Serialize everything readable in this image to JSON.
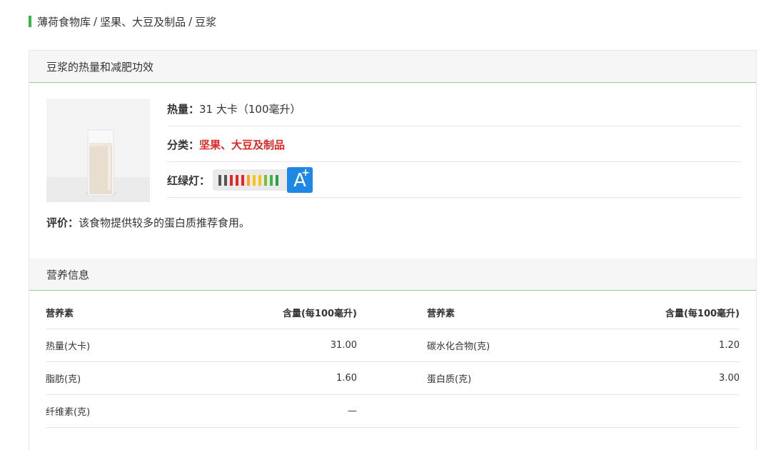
{
  "breadcrumb": {
    "home": "薄荷食物库",
    "sep1": "/",
    "category": "坚果、大豆及制品",
    "sep2": "/",
    "current": "豆浆"
  },
  "overview": {
    "title": "豆浆的热量和减肥功效",
    "calories_label": "热量：",
    "calories_value": "31 大卡（100毫升）",
    "category_label": "分类：",
    "category_value": "坚果、大豆及制品",
    "traffic_label": "红绿灯：",
    "grade": "A",
    "grade_plus": "+",
    "traffic_colors": [
      "#555555",
      "#555555",
      "#e22727",
      "#e22727",
      "#e22727",
      "#f5a623",
      "#f5c518",
      "#f5c518",
      "#7cbd3a",
      "#39b54a",
      "#2e9e44",
      "#1e88e5"
    ],
    "eval_label": "评价：",
    "eval_value": "该食物提供较多的蛋白质推荐食用。"
  },
  "nutrition": {
    "title": "营养信息",
    "headers": [
      "营养素",
      "含量(每100毫升)",
      "营养素",
      "含量(每100毫升)"
    ],
    "rows": [
      [
        "热量(大卡)",
        "31.00",
        "碳水化合物(克)",
        "1.20"
      ],
      [
        "脂肪(克)",
        "1.60",
        "蛋白质(克)",
        "3.00"
      ],
      [
        "纤维素(克)",
        "—",
        "",
        ""
      ]
    ]
  },
  "colors": {
    "accent_green": "#39b54a",
    "red": "#e22727",
    "grade_blue": "#1e88e5"
  }
}
